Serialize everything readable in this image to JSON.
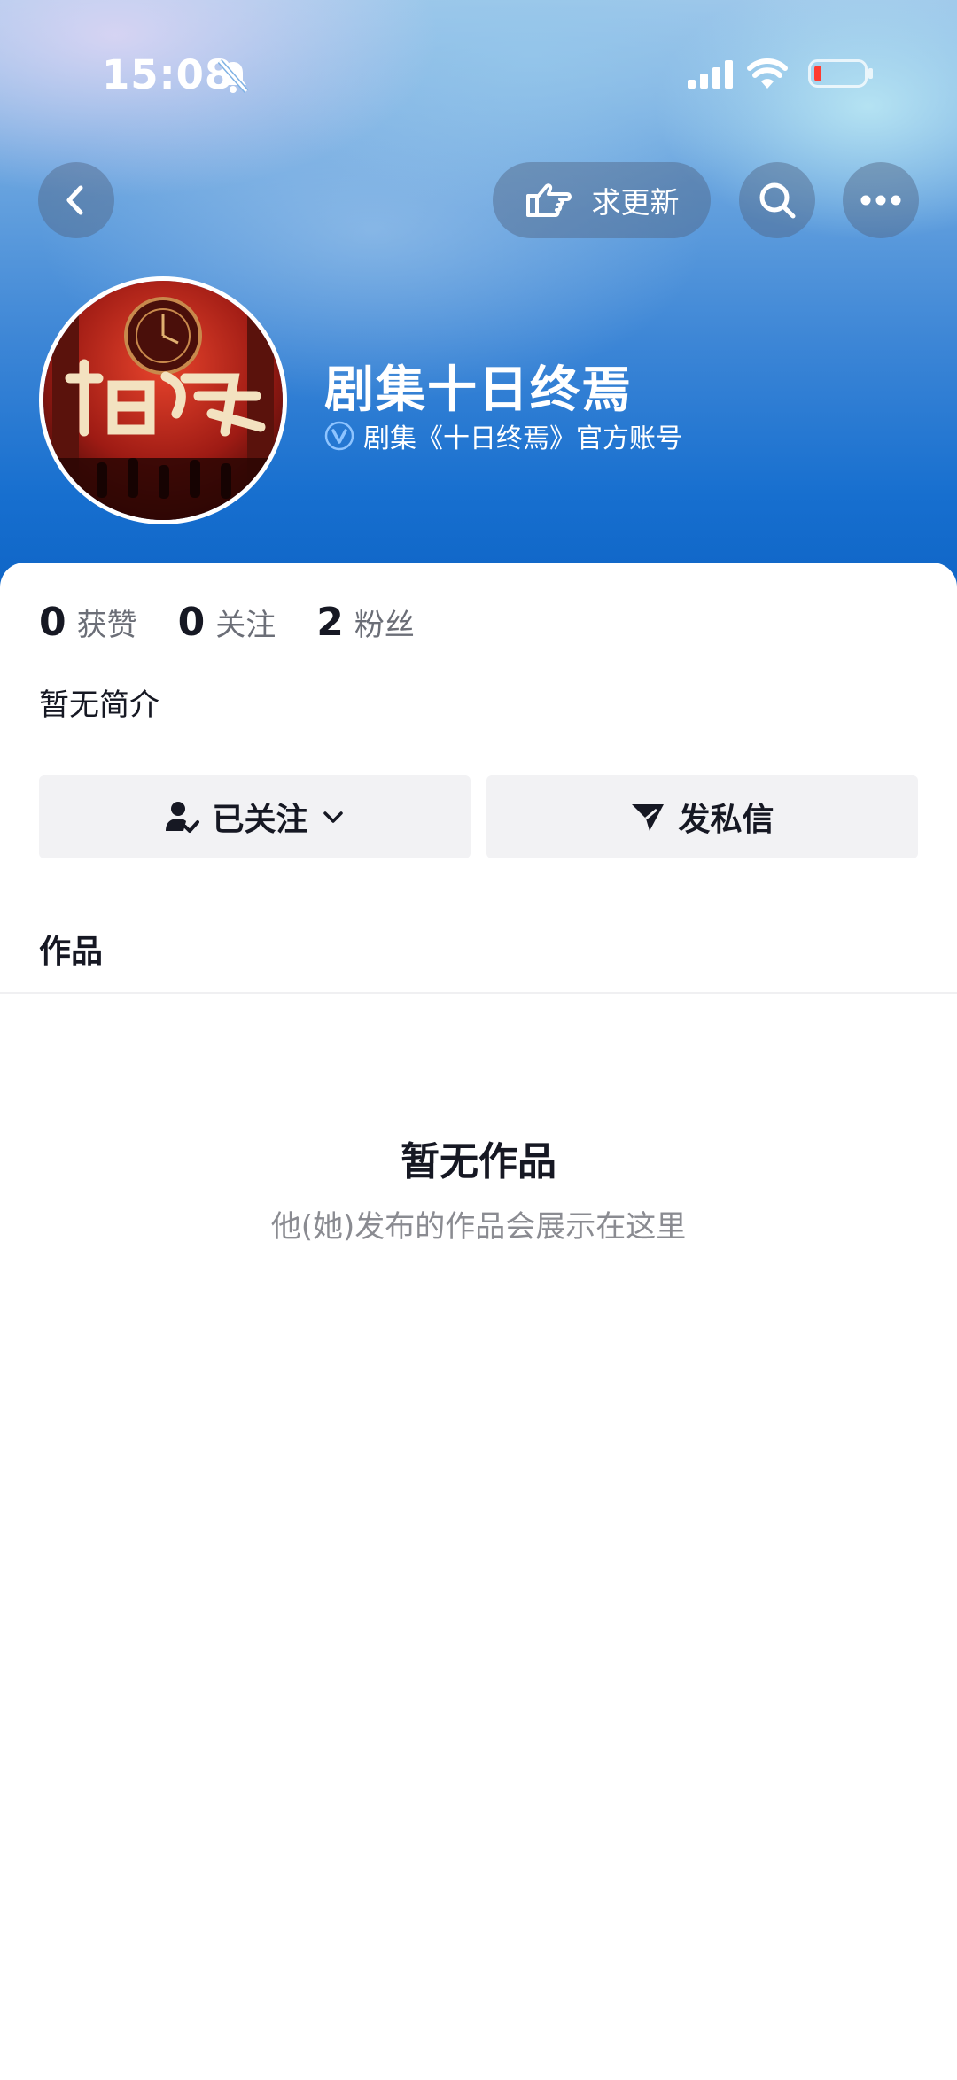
{
  "status_bar": {
    "time": "15:08",
    "battery_color": "#ff3b30"
  },
  "top_bar": {
    "back_icon": "chevron-left-icon",
    "update_button_label": "求更新",
    "update_icon": "pointing-hand-icon",
    "search_icon": "search-icon",
    "more_icon": "more-horizontal-icon"
  },
  "profile": {
    "name": "剧集十日终焉",
    "verified_text": "剧集《十日终焉》官方账号",
    "verified_icon": "verified-badge-icon",
    "avatar_text": "十日终焉"
  },
  "stats": [
    {
      "value": "0",
      "label": "获赞"
    },
    {
      "value": "0",
      "label": "关注"
    },
    {
      "value": "2",
      "label": "粉丝"
    }
  ],
  "bio": "暂无简介",
  "actions": {
    "follow_label": "已关注",
    "message_label": "发私信"
  },
  "tabs": {
    "works_label": "作品"
  },
  "empty_state": {
    "title": "暂无作品",
    "subtitle": "他(她)发布的作品会展示在这里"
  }
}
